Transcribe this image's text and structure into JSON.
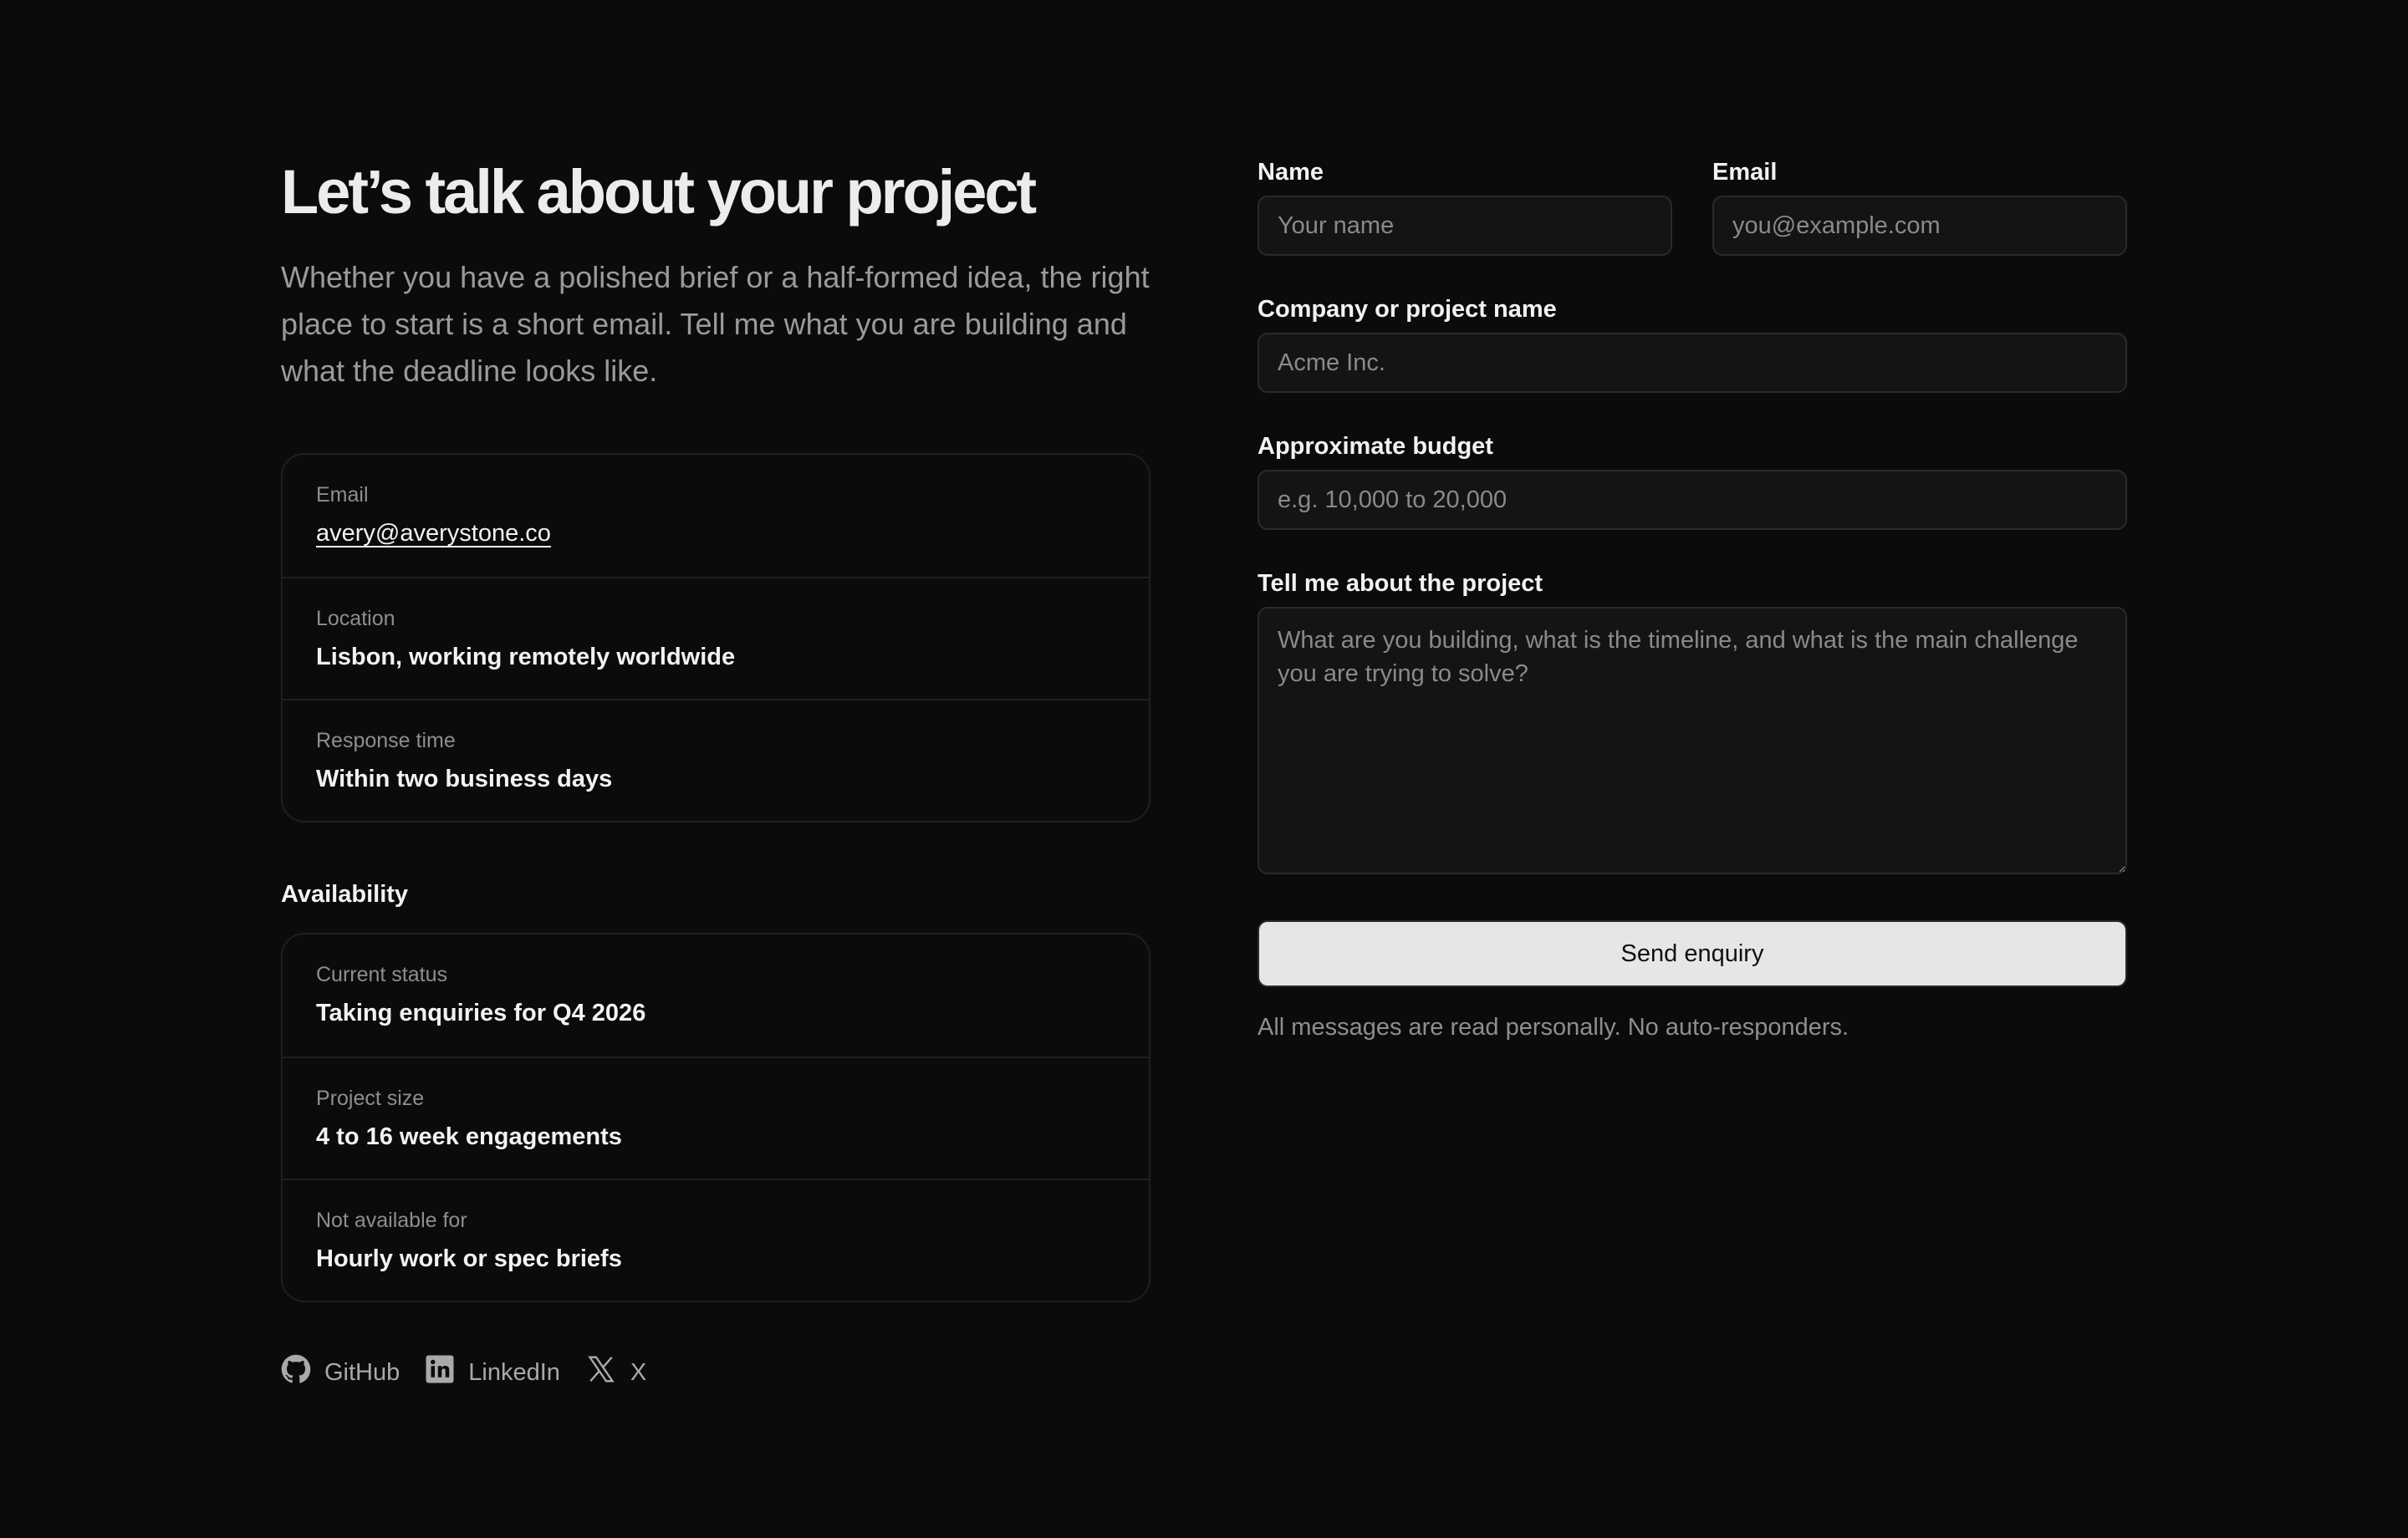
{
  "intro": {
    "title": "Let’s talk about your project",
    "lead": "Whether you have a polished brief or a half-formed idea, the right place to start is a short email. Tell me what you are building and what the deadline looks like."
  },
  "contact": {
    "email": {
      "label": "Email",
      "value": "avery@averystone.co"
    },
    "location": {
      "label": "Location",
      "value": "Lisbon, working remotely worldwide"
    },
    "response": {
      "label": "Response time",
      "value": "Within two business days"
    }
  },
  "availability": {
    "heading": "Availability",
    "status": {
      "label": "Current status",
      "value": "Taking enquiries for Q4 2026"
    },
    "size": {
      "label": "Project size",
      "value": "4 to 16 week engagements"
    },
    "not_available": {
      "label": "Not available for",
      "value": "Hourly work or spec briefs"
    }
  },
  "socials": [
    {
      "label": "GitHub",
      "icon": "github-icon"
    },
    {
      "label": "LinkedIn",
      "icon": "linkedin-icon"
    },
    {
      "label": "X",
      "icon": "x-icon"
    }
  ],
  "form": {
    "name": {
      "label": "Name",
      "placeholder": "Your name",
      "value": ""
    },
    "email": {
      "label": "Email",
      "placeholder": "you@example.com",
      "value": ""
    },
    "company": {
      "label": "Company or project name",
      "placeholder": "Acme Inc.",
      "value": ""
    },
    "budget": {
      "label": "Approximate budget",
      "placeholder": "e.g. 10,000 to 20,000",
      "value": ""
    },
    "message": {
      "label": "Tell me about the project",
      "placeholder": "What are you building, what is the timeline, and what is the main challenge you are trying to solve?",
      "value": ""
    },
    "submit_label": "Send enquiry",
    "note": "All messages are read personally. No auto-responders."
  },
  "colors": {
    "background": "#0b0b0b",
    "text": "#f2f2f2",
    "muted": "#9a9a9a",
    "border": "#1f1f1f",
    "input_bg": "#141414",
    "button_bg": "#e6e6e6"
  }
}
